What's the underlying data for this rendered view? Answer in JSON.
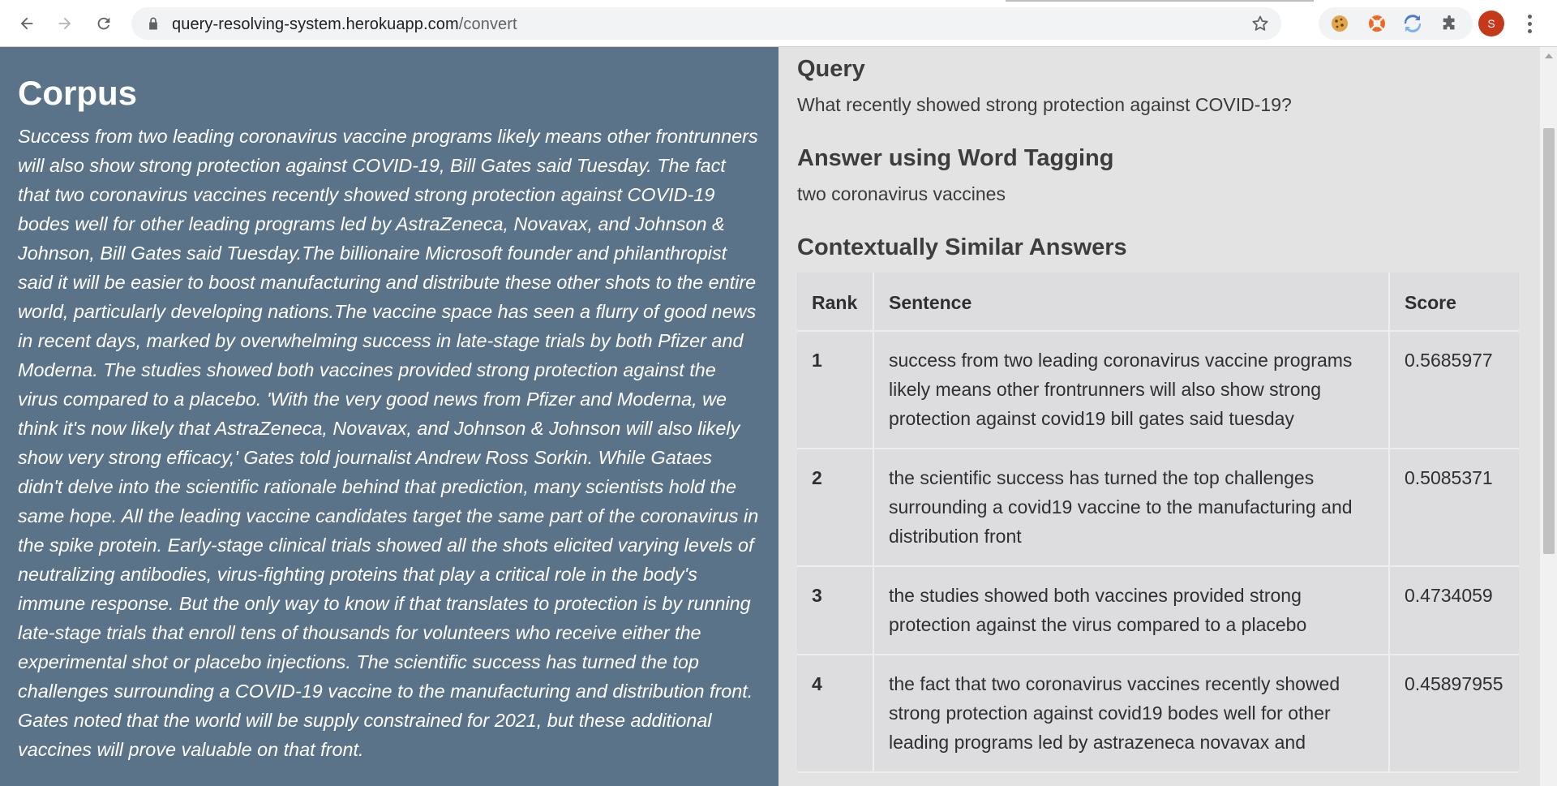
{
  "browser": {
    "url_host": "query-resolving-system.herokuapp.com",
    "url_path": "/convert",
    "avatar_letter": "S",
    "icons": [
      "back-arrow-icon",
      "forward-arrow-icon",
      "reload-icon",
      "lock-icon",
      "star-icon",
      "cookie-extension-icon",
      "lifebuoy-extension-icon",
      "sync-extension-icon",
      "puzzle-extensions-icon",
      "kebab-menu-icon"
    ]
  },
  "corpus": {
    "title": "Corpus",
    "text": "Success from two leading coronavirus vaccine programs likely means other frontrunners will also show strong protection against COVID-19, Bill Gates said Tuesday. The fact that two coronavirus vaccines recently showed strong protection against COVID-19 bodes well for other leading programs led by AstraZeneca, Novavax, and Johnson & Johnson, Bill Gates said Tuesday.The billionaire Microsoft founder and philanthropist said it will be easier to boost manufacturing and distribute these other shots to the entire world, particularly developing nations.The vaccine space has seen a flurry of good news in recent days, marked by overwhelming success in late-stage trials by both Pfizer and Moderna. The studies showed both vaccines provided strong protection against the virus compared to a placebo. 'With the very good news from Pfizer and Moderna, we think it's now likely that AstraZeneca, Novavax, and Johnson & Johnson will also likely show very strong efficacy,' Gates told journalist Andrew Ross Sorkin. While Gataes didn't delve into the scientific rationale behind that prediction, many scientists hold the same hope. All the leading vaccine candidates target the same part of the coronavirus in the spike protein. Early-stage clinical trials showed all the shots elicited varying levels of neutralizing antibodies, virus-fighting proteins that play a critical role in the body's immune response. But the only way to know if that translates to protection is by running late-stage trials that enroll tens of thousands for volunteers who receive either the experimental shot or placebo injections. The scientific success has turned the top challenges surrounding a COVID-19 vaccine to the manufacturing and distribution front. Gates noted that the world will be supply constrained for 2021, but these additional vaccines will prove valuable on that front."
  },
  "query": {
    "title": "Query",
    "text": "What recently showed strong protection against COVID-19?"
  },
  "answer": {
    "title": "Answer using Word Tagging",
    "text": "two coronavirus vaccines"
  },
  "similar": {
    "title": "Contextually Similar Answers",
    "headers": {
      "rank": "Rank",
      "sentence": "Sentence",
      "score": "Score"
    },
    "rows": [
      {
        "rank": "1",
        "sentence": "success from two leading coronavirus vaccine programs likely means other frontrunners will also show strong protection against covid19 bill gates said tuesday",
        "score": "0.5685977"
      },
      {
        "rank": "2",
        "sentence": "the scientific success has turned the top challenges surrounding a covid19 vaccine to the manufacturing and distribution front",
        "score": "0.5085371"
      },
      {
        "rank": "3",
        "sentence": "the studies showed both vaccines provided strong protection against the virus compared to a placebo",
        "score": "0.4734059"
      },
      {
        "rank": "4",
        "sentence": "the fact that two coronavirus vaccines recently showed strong protection against covid19 bodes well for other leading programs led by astrazeneca novavax and",
        "score": "0.45897955"
      }
    ]
  },
  "colors": {
    "corpus_bg": "#5b7389",
    "results_bg": "#e3e3e3",
    "table_bg": "#dddddf",
    "avatar_bg": "#c5391a"
  }
}
